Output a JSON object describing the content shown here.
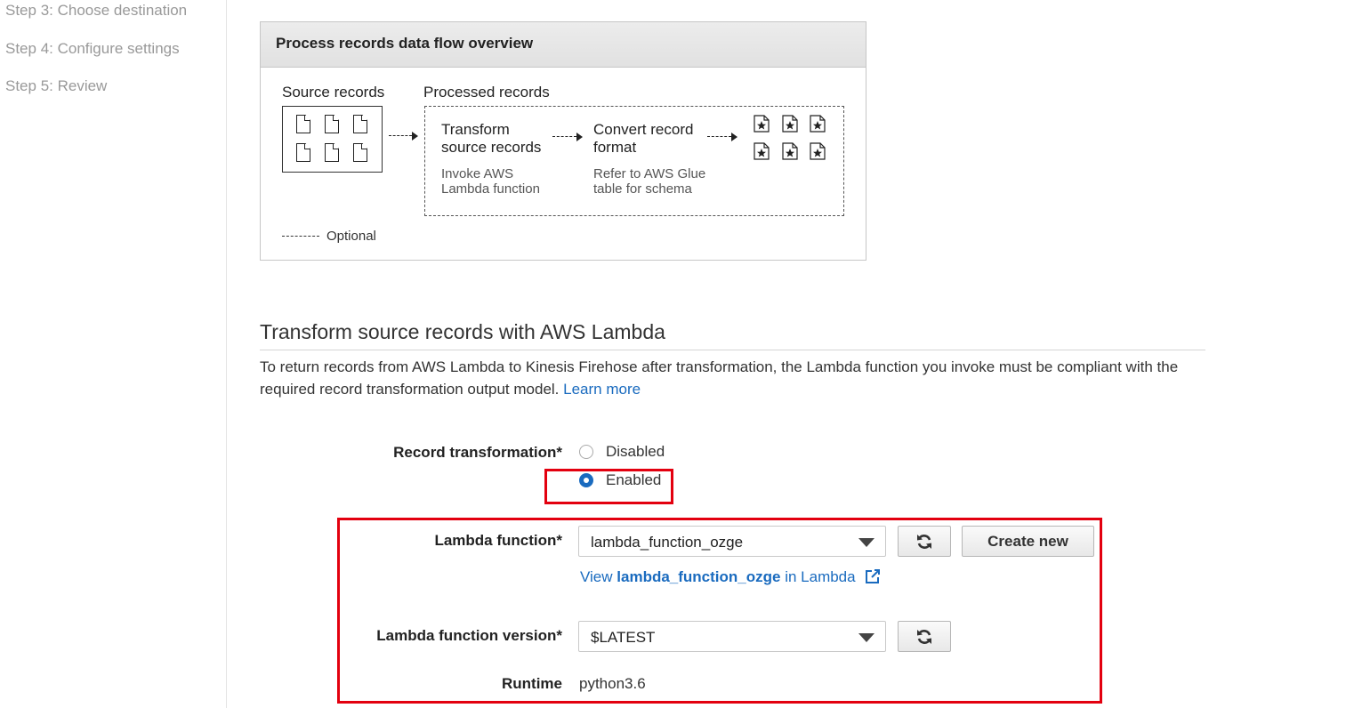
{
  "sidebar": {
    "steps": [
      "Step 3: Choose destination",
      "Step 4: Configure settings",
      "Step 5: Review"
    ]
  },
  "overview": {
    "title": "Process records data flow overview",
    "source_label": "Source records",
    "processed_label": "Processed records",
    "transform_title_1": "Transform",
    "transform_title_2": "source records",
    "transform_sub_1": "Invoke AWS",
    "transform_sub_2": "Lambda function",
    "convert_title_1": "Convert record",
    "convert_title_2": "format",
    "convert_sub_1": "Refer to AWS Glue",
    "convert_sub_2": "table for schema",
    "legend_label": "Optional"
  },
  "section": {
    "title": "Transform source records with AWS Lambda",
    "description": "To return records from AWS Lambda to Kinesis Firehose after transformation, the Lambda function you invoke must be compliant with the required record transformation output model.",
    "learn_more": "Learn more"
  },
  "form": {
    "record_transformation_label": "Record transformation*",
    "options": [
      "Disabled",
      "Enabled"
    ],
    "selected_option": "Enabled",
    "lambda_function_label": "Lambda function*",
    "lambda_function_value": "lambda_function_ozge",
    "create_new_label": "Create new",
    "view_link_prefix": "View",
    "view_link_name": "lambda_function_ozge",
    "view_link_suffix": "in Lambda",
    "lambda_version_label": "Lambda function version*",
    "lambda_version_value": "$LATEST",
    "runtime_label": "Runtime",
    "runtime_value": "python3.6"
  },
  "colors": {
    "accent": "#1a6bbf",
    "highlight": "#e3000f"
  },
  "icons": [
    "document-icon",
    "starred-document-icon",
    "refresh-icon",
    "external-link-icon",
    "dropdown-caret-icon"
  ]
}
